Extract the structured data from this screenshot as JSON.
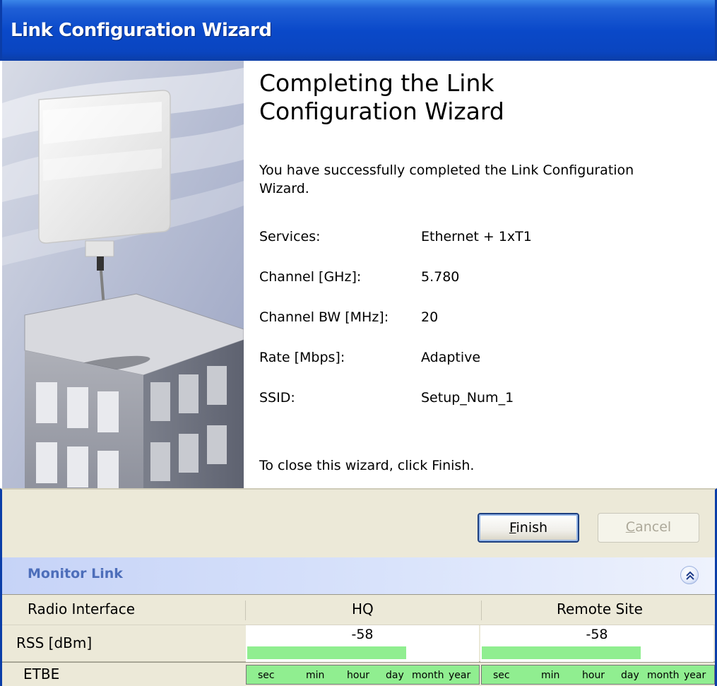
{
  "window": {
    "title": "Link Configuration Wizard"
  },
  "wizard": {
    "heading_line1": "Completing the Link",
    "heading_line2": "Configuration Wizard",
    "intro": "You have successfully completed the Link Configuration Wizard.",
    "summary": [
      {
        "label": "Services:",
        "value": "Ethernet + 1xT1"
      },
      {
        "label": "Channel [GHz]:",
        "value": "5.780"
      },
      {
        "label": "Channel BW [MHz]:",
        "value": "20"
      },
      {
        "label": "Rate [Mbps]:",
        "value": "Adaptive"
      },
      {
        "label": "SSID:",
        "value": "Setup_Num_1"
      }
    ],
    "closing": "To close this wizard, click Finish."
  },
  "buttons": {
    "finish_mnemonic": "F",
    "finish_rest": "inish",
    "cancel_mnemonic": "C",
    "cancel_rest": "ancel"
  },
  "monitor": {
    "title": "Monitor Link",
    "collapse_icon": "double-chevron-up-icon",
    "columns": [
      "Radio Interface",
      "HQ",
      "Remote Site"
    ],
    "rss": {
      "label": "RSS [dBm]",
      "hq": "-58",
      "remote": "-58",
      "hq_level": 0.69,
      "remote_level": 0.69
    },
    "etbe": {
      "label": "ETBE",
      "ticks": [
        "sec",
        "min",
        "hour",
        "day",
        "month",
        "year"
      ]
    }
  },
  "colors": {
    "titlebar": "#0a49c9",
    "level_bar": "#90ee90",
    "monitor_title": "#4d6eba",
    "dialog_bg": "#ece9d8"
  }
}
